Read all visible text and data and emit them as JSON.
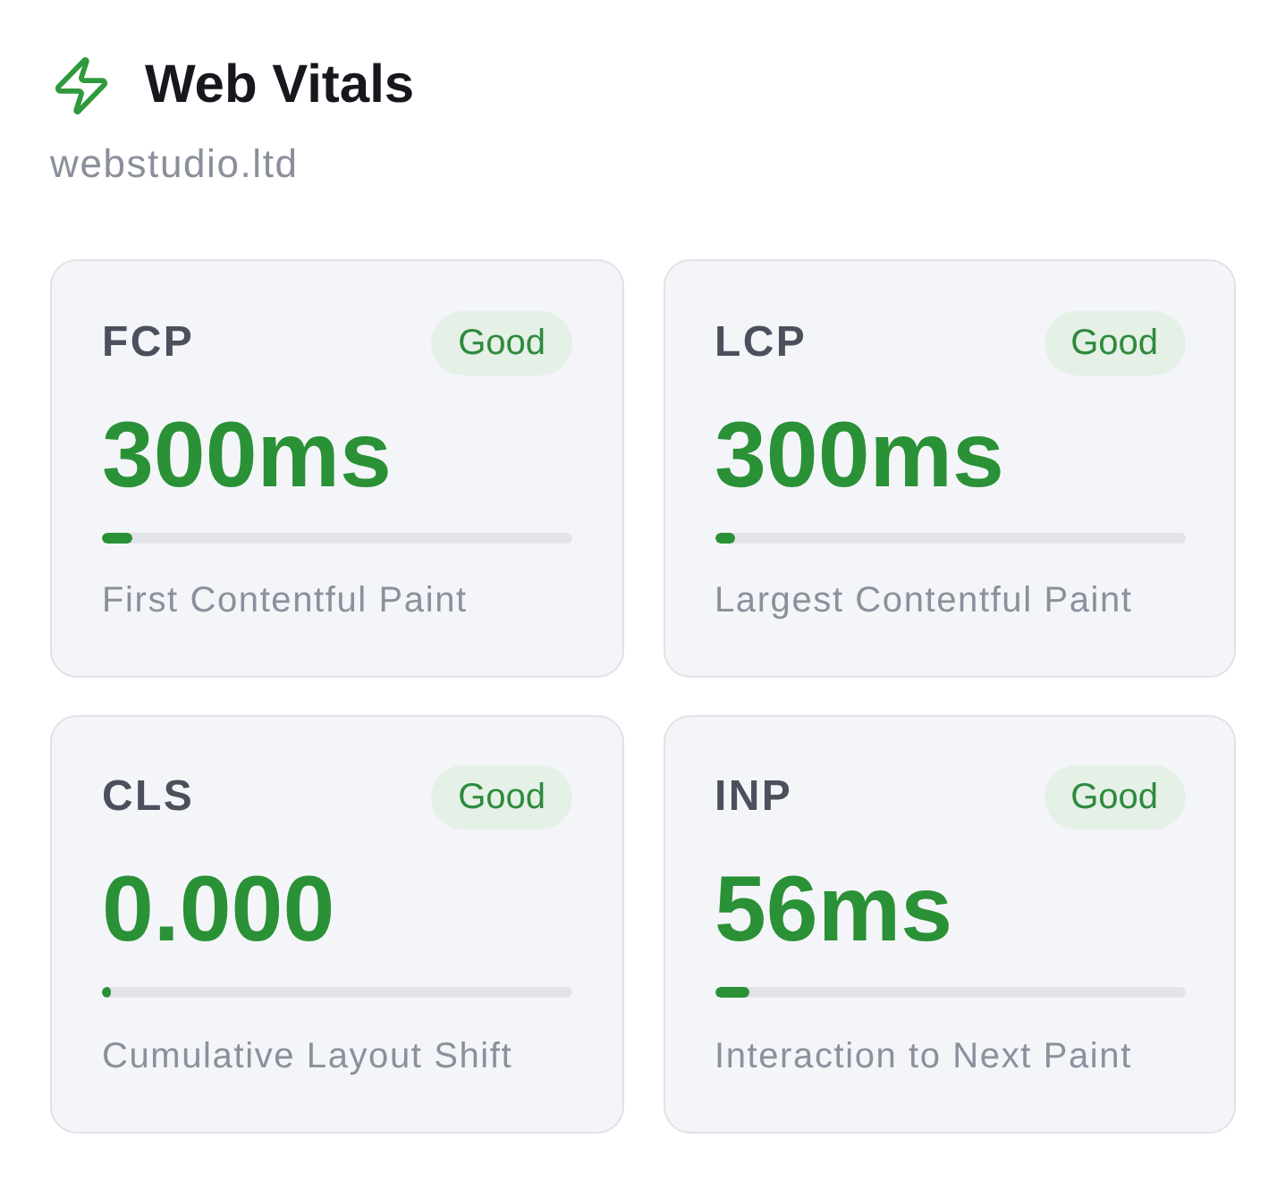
{
  "header": {
    "title": "Web Vitals",
    "subtitle": "webstudio.ltd"
  },
  "metrics": [
    {
      "abbr": "FCP",
      "rating": "Good",
      "value": "300ms",
      "level": 0.065,
      "description": "First Contentful Paint"
    },
    {
      "abbr": "LCP",
      "rating": "Good",
      "value": "300ms",
      "level": 0.045,
      "description": "Largest Contentful Paint"
    },
    {
      "abbr": "CLS",
      "rating": "Good",
      "value": "0.000",
      "level": 0.02,
      "description": "Cumulative Layout Shift"
    },
    {
      "abbr": "INP",
      "rating": "Good",
      "value": "56ms",
      "level": 0.076,
      "description": "Interaction to Next Paint"
    }
  ]
}
